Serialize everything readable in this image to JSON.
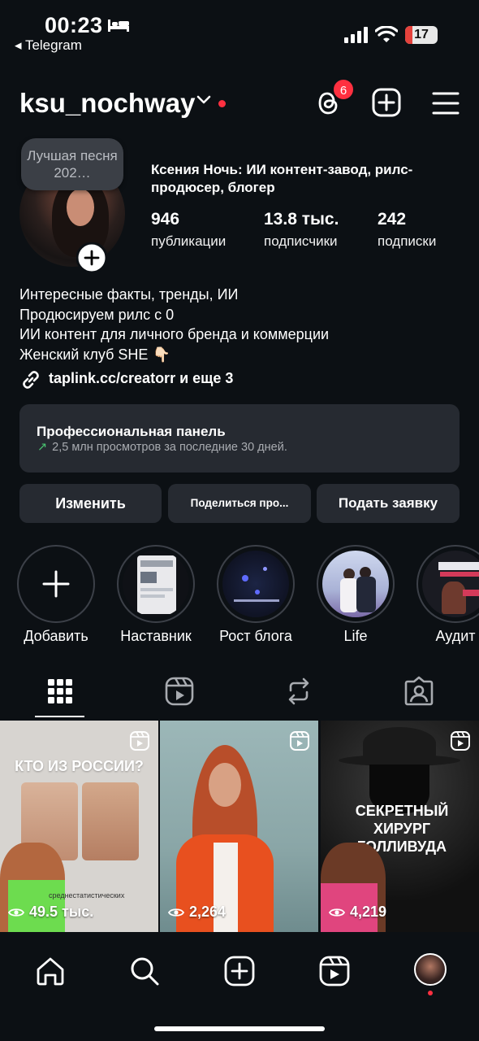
{
  "status_bar": {
    "time": "00:23",
    "back_app": "◂ Telegram",
    "battery": "17"
  },
  "header": {
    "username": "ksu_nochway",
    "threads_badge": "6"
  },
  "profile": {
    "note": "Лучшая песня 202…",
    "display_name": "Ксения Ночь: ИИ контент-завод, рилс-продюсер, блогер",
    "stats": [
      {
        "value": "946",
        "label": "публикации"
      },
      {
        "value": "13.8 тыс.",
        "label": "подписчики"
      },
      {
        "value": "242",
        "label": "подписки"
      }
    ],
    "bio": [
      "Интересные факты, тренды, ИИ",
      "Продюсируем рилс с 0",
      "ИИ контент для личного бренда и коммерции",
      "Женский клуб SHE 👇🏻"
    ],
    "link": "taplink.cc/creatorr и еще 3"
  },
  "pro_panel": {
    "title": "Профессиональная панель",
    "subtitle": "2,5 млн просмотров за последние 30 дней."
  },
  "buttons": {
    "edit": "Изменить",
    "share": "Поделиться про...",
    "apply": "Подать заявку"
  },
  "highlights": [
    {
      "label": "Добавить"
    },
    {
      "label": "Наставник"
    },
    {
      "label": "Рост блога"
    },
    {
      "label": "Life"
    },
    {
      "label": "Аудит"
    }
  ],
  "grid": [
    {
      "title": "КТО ИЗ РОССИИ?",
      "caption": "среднестатистических",
      "views": "49.5 тыс."
    },
    {
      "views": "2,264"
    },
    {
      "title": "СЕКРЕТНЫЙ ХИРУРГ ГОЛЛИВУДА",
      "views": "4,219"
    }
  ],
  "colors": {
    "background": "#0c1014",
    "panel": "#262a31",
    "accent_red": "#ff3040",
    "trend_green": "#49c26f"
  }
}
